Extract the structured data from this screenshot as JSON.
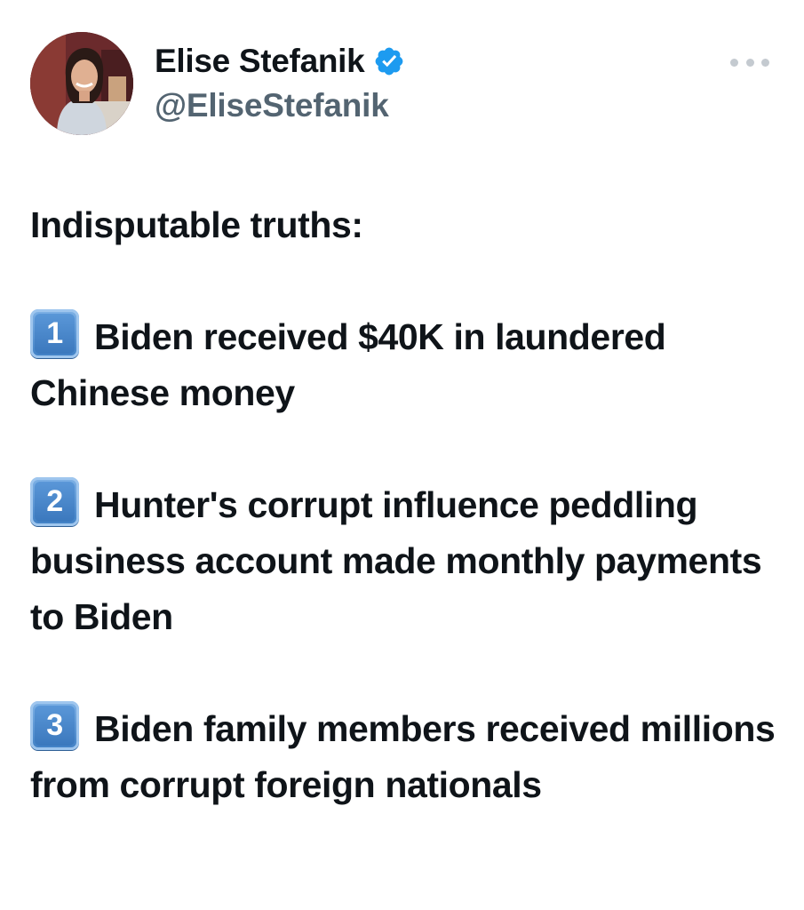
{
  "author": {
    "display_name": "Elise Stefanik",
    "handle": "@EliseStefanik",
    "verified": true,
    "verified_color": "#1d9bf0"
  },
  "icons": {
    "verified": "verified-badge-icon",
    "more": "more-options-icon",
    "keycap_1": "keycap-digit-one-icon",
    "keycap_2": "keycap-digit-two-icon",
    "keycap_3": "keycap-digit-three-icon"
  },
  "tweet": {
    "intro": "Indisputable truths:",
    "points": [
      {
        "number": "1",
        "text": "Biden received $40K in laundered Chinese money"
      },
      {
        "number": "2",
        "text": "Hunter's corrupt influence peddling business account made monthly payments to Biden"
      },
      {
        "number": "3",
        "text": "Biden family members received millions from corrupt foreign nationals"
      }
    ]
  },
  "colors": {
    "text_primary": "#0f1419",
    "text_secondary": "#536471",
    "keycap_blue": "#4a8ad0"
  }
}
